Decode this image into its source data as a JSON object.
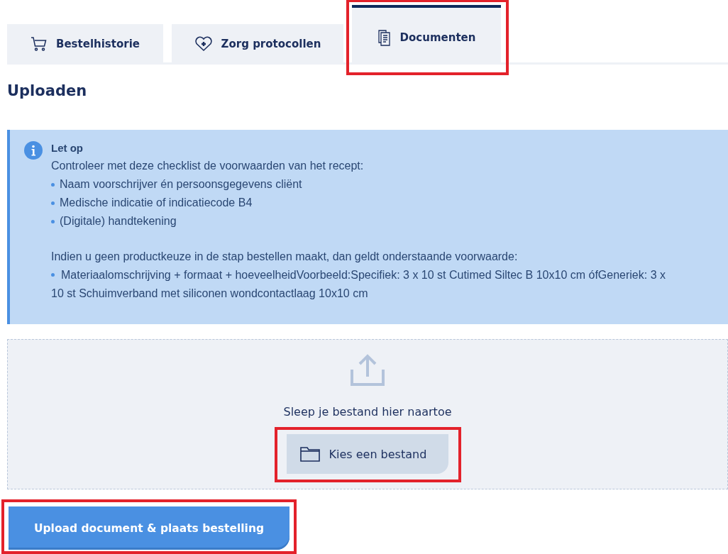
{
  "tabs": [
    {
      "label": "Bestelhistorie",
      "kind": "cart",
      "selected": false,
      "highlighted": false
    },
    {
      "label": "Zorg protocollen",
      "kind": "heart",
      "selected": false,
      "highlighted": false
    },
    {
      "label": "Documenten",
      "kind": "document",
      "selected": true,
      "highlighted": true
    }
  ],
  "heading": "Uploaden",
  "notice": {
    "title": "Let op",
    "intro": "Controleer met deze checklist de voorwaarden van het recept:",
    "bullets": [
      "Naam voorschrijver én persoonsgegevens cliënt",
      "Medische indicatie of indicatiecode B4",
      "(Digitale) handtekening"
    ],
    "note": "Indien u geen productkeuze in de stap bestellen maakt, dan geldt onderstaande voorwaarde:",
    "note_bullets": [
      "Materiaalomschrijving + formaat + hoeveelheidVoorbeeld:Specifiek: 3 x 10 st Cutimed Siltec B 10x10 cm ófGeneriek: 3 x 10 st Schuimverband met siliconen wondcontactlaag 10x10 cm"
    ]
  },
  "dropzone": {
    "hint": "Sleep je bestand hier naartoe",
    "button": {
      "label": "Kies een bestand",
      "highlighted": true
    }
  },
  "submit": {
    "label": "Upload document & plaats bestelling",
    "highlighted": true
  }
}
